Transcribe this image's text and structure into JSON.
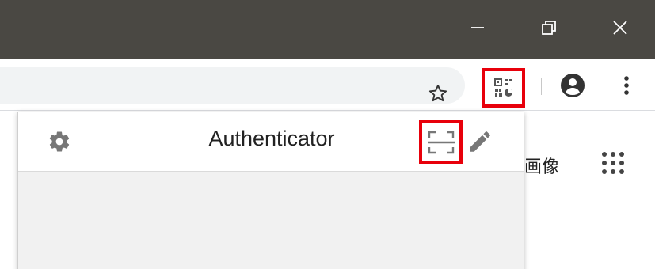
{
  "window": {
    "minimize_glyph": "—",
    "restore_icon": "restore-icon",
    "close_glyph": "✕",
    "titlebar_color": "#4a4843"
  },
  "toolbar": {
    "star_icon": "bookmark-star-icon",
    "extension_icon": "qr-code-icon",
    "avatar_icon": "account-avatar-icon",
    "menu_icon": "kebab-menu-icon"
  },
  "page": {
    "partial_text": "画像",
    "apps_icon": "apps-grid-icon"
  },
  "popup": {
    "title": "Authenticator",
    "settings_icon": "gear-icon",
    "scan_icon": "scan-qr-icon",
    "edit_icon": "pencil-icon"
  },
  "highlight": {
    "color": "#e8000b"
  }
}
